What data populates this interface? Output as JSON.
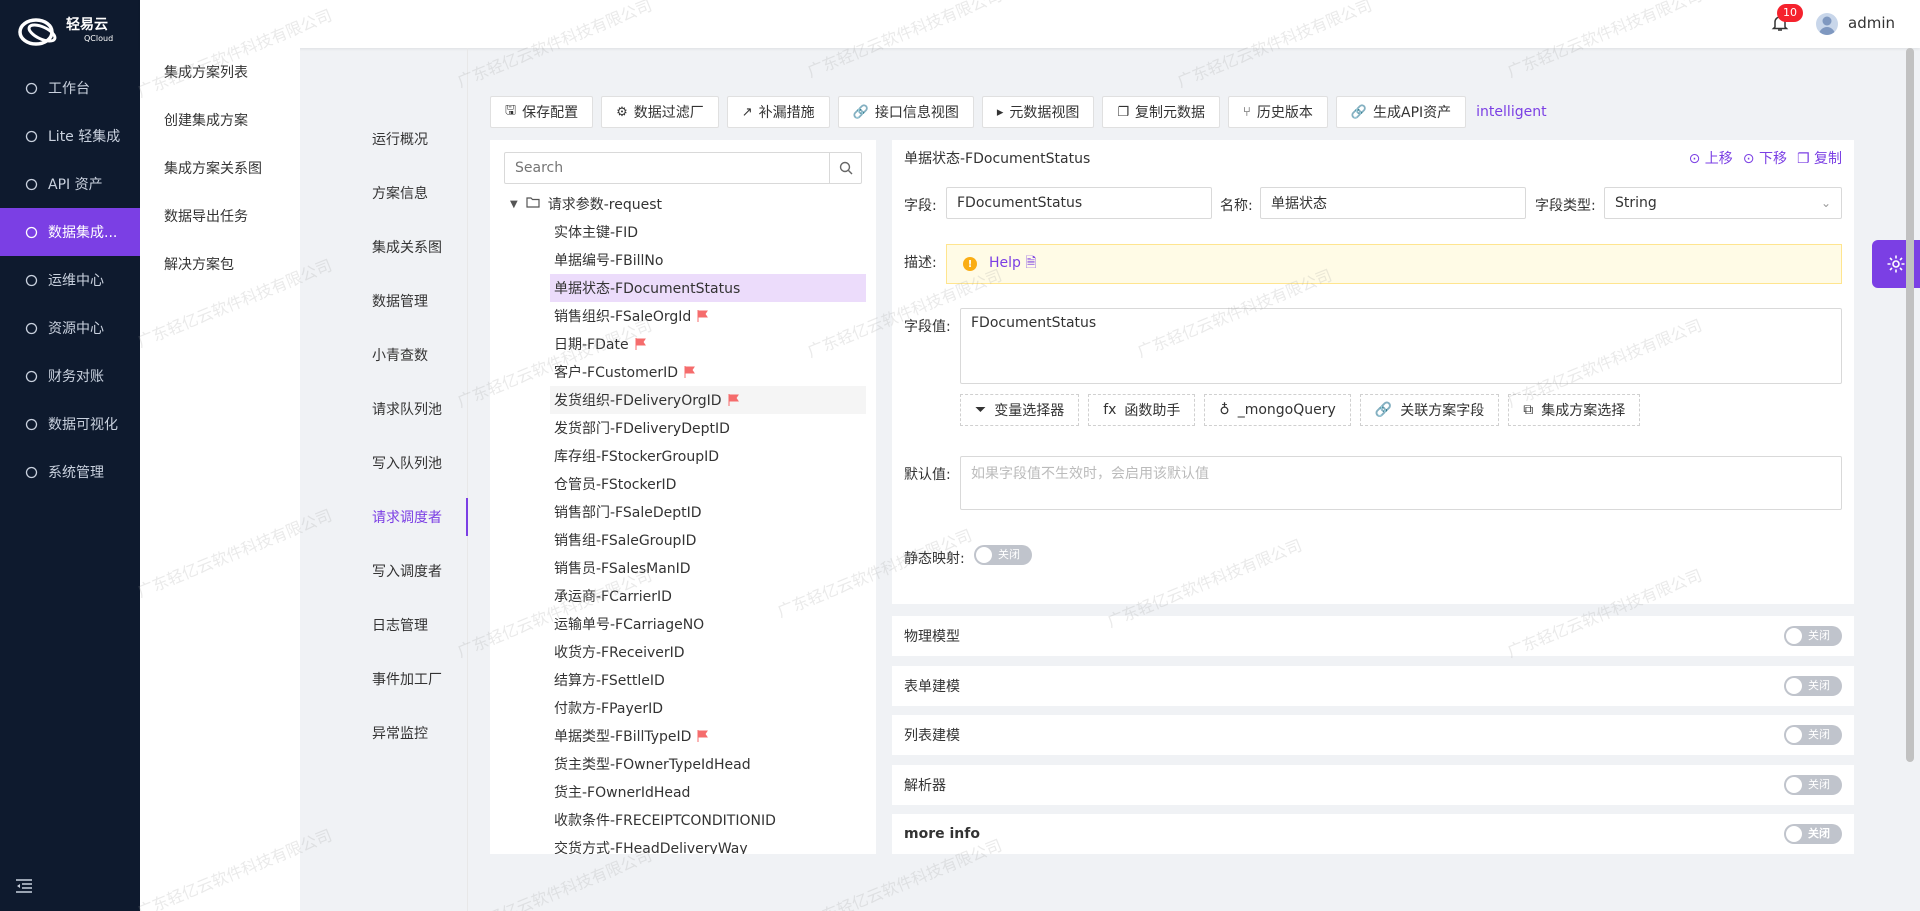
{
  "brand": {
    "name": "轻易云",
    "sub": "QCloud"
  },
  "nav": [
    {
      "label": "工作台",
      "icon": "clock-icon"
    },
    {
      "label": "Lite 轻集成",
      "icon": "bulb-icon"
    },
    {
      "label": "API 资产",
      "icon": "compass-icon"
    },
    {
      "label": "数据集成...",
      "icon": "network-icon",
      "active": true
    },
    {
      "label": "运维中心",
      "icon": "bolt-icon"
    },
    {
      "label": "资源中心",
      "icon": "cluster-icon"
    },
    {
      "label": "财务对账",
      "icon": "calculator-icon"
    },
    {
      "label": "数据可视化",
      "icon": "bar-chart-icon"
    },
    {
      "label": "系统管理",
      "icon": "grid-icon"
    }
  ],
  "submenu": [
    "集成方案列表",
    "创建集成方案",
    "集成方案关系图",
    "数据导出任务",
    "解决方案包"
  ],
  "header": {
    "notifications": "10",
    "username": "admin"
  },
  "vtabs": [
    "运行概况",
    "方案信息",
    "集成关系图",
    "数据管理",
    "小青查数",
    "请求队列池",
    "写入队列池",
    "请求调度者",
    "写入调度者",
    "日志管理",
    "事件加工厂",
    "异常监控"
  ],
  "toolbar": [
    {
      "label": "保存配置",
      "icon": "save-icon",
      "glyph": "🖫"
    },
    {
      "label": "数据过滤厂",
      "icon": "gear-icon",
      "glyph": "⚙"
    },
    {
      "label": "补漏措施",
      "icon": "line-chart-icon",
      "glyph": "↗"
    },
    {
      "label": "接口信息视图",
      "icon": "link-icon",
      "glyph": "🔗"
    },
    {
      "label": "元数据视图",
      "icon": "terminal-icon",
      "glyph": "▸"
    },
    {
      "label": "复制元数据",
      "icon": "copy-icon",
      "glyph": "❐"
    },
    {
      "label": "历史版本",
      "icon": "branch-icon",
      "glyph": "⑂"
    },
    {
      "label": "生成API资产",
      "icon": "link-icon",
      "glyph": "🔗"
    }
  ],
  "toolbar_link": "intelligent",
  "tree": {
    "search_placeholder": "Search",
    "root": "请求参数-request",
    "nodes": [
      {
        "label": "实体主键-FID"
      },
      {
        "label": "单据编号-FBillNo"
      },
      {
        "label": "单据状态-FDocumentStatus",
        "selected": true
      },
      {
        "label": "销售组织-FSaleOrgId",
        "flag": true
      },
      {
        "label": "日期-FDate",
        "flag": true
      },
      {
        "label": "客户-FCustomerID",
        "flag": true
      },
      {
        "label": "发货组织-FDeliveryOrgID",
        "flag": true,
        "hover": true
      },
      {
        "label": "发货部门-FDeliveryDeptID"
      },
      {
        "label": "库存组-FStockerGroupID"
      },
      {
        "label": "仓管员-FStockerID"
      },
      {
        "label": "销售部门-FSaleDeptID"
      },
      {
        "label": "销售组-FSaleGroupID"
      },
      {
        "label": "销售员-FSalesManID"
      },
      {
        "label": "承运商-FCarrierID"
      },
      {
        "label": "运输单号-FCarriageNO"
      },
      {
        "label": "收货方-FReceiverID"
      },
      {
        "label": "结算方-FSettleID"
      },
      {
        "label": "付款方-FPayerID"
      },
      {
        "label": "单据类型-FBillTypeID",
        "flag": true
      },
      {
        "label": "货主类型-FOwnerTypeIdHead"
      },
      {
        "label": "货主-FOwnerIdHead"
      },
      {
        "label": "收款条件-FRECEIPTCONDITIONID"
      },
      {
        "label": "交货方式-FHeadDeliveryWay"
      }
    ]
  },
  "detail": {
    "title": "单据状态-FDocumentStatus",
    "actions": {
      "up": "上移",
      "down": "下移",
      "copy": "复制"
    },
    "field_label": "字段:",
    "field_value": "FDocumentStatus",
    "name_label": "名称:",
    "name_value": "单据状态",
    "type_label": "字段类型:",
    "type_value": "String",
    "desc_label": "描述:",
    "help": "Help",
    "value_label": "字段值:",
    "value_value": "FDocumentStatus",
    "buttons": [
      {
        "label": "变量选择器",
        "icon": "filter-icon",
        "glyph": "⏷"
      },
      {
        "label": "函数助手",
        "icon": "function-icon",
        "glyph": "fx"
      },
      {
        "label": "_mongoQuery",
        "icon": "bulb-icon",
        "glyph": "♁"
      },
      {
        "label": "关联方案字段",
        "icon": "link-icon",
        "glyph": "🔗"
      },
      {
        "label": "集成方案选择",
        "icon": "block-icon",
        "glyph": "⧉"
      }
    ],
    "default_label": "默认值:",
    "default_placeholder": "如果字段值不生效时，会启用该默认值",
    "static_label": "静态映射:",
    "switch_off": "关闭"
  },
  "sections": [
    "物理模型",
    "表单建模",
    "列表建模",
    "解析器",
    "more info"
  ],
  "watermark": "广东轻亿云软件科技有限公司",
  "colors": {
    "accent": "#7b3fe4",
    "nav_bg": "#0e1a2e",
    "flag": "#f56c6c"
  }
}
